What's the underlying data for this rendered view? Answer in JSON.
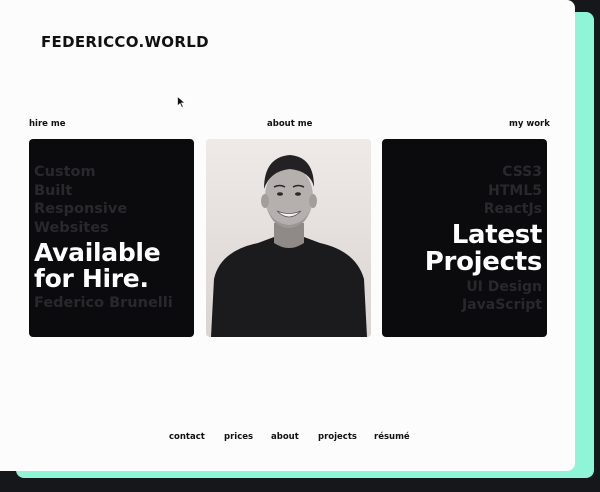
{
  "header": {
    "logo": "FEDERICCO.WORLD"
  },
  "columns": {
    "hire": "hire me",
    "about": "about me",
    "work": "my work"
  },
  "hire_card": {
    "muted_top": [
      "Custom",
      "Built",
      "Responsive",
      "Websites"
    ],
    "headline": [
      "Available",
      "for Hire."
    ],
    "muted_bottom": "Federico Brunelli"
  },
  "work_card": {
    "muted_top": [
      "CSS3",
      "HTML5",
      "ReactJs"
    ],
    "headline": [
      "Latest",
      "Projects"
    ],
    "muted_bottom": [
      "UI Design",
      "JavaScript"
    ]
  },
  "footer": {
    "links": [
      "contact",
      "prices",
      "about",
      "projects",
      "résumé"
    ]
  },
  "colors": {
    "accent_shadow": "#8ef5d6",
    "card_dark": "#0b0a0d",
    "page_bg": "#fcfcfd"
  }
}
